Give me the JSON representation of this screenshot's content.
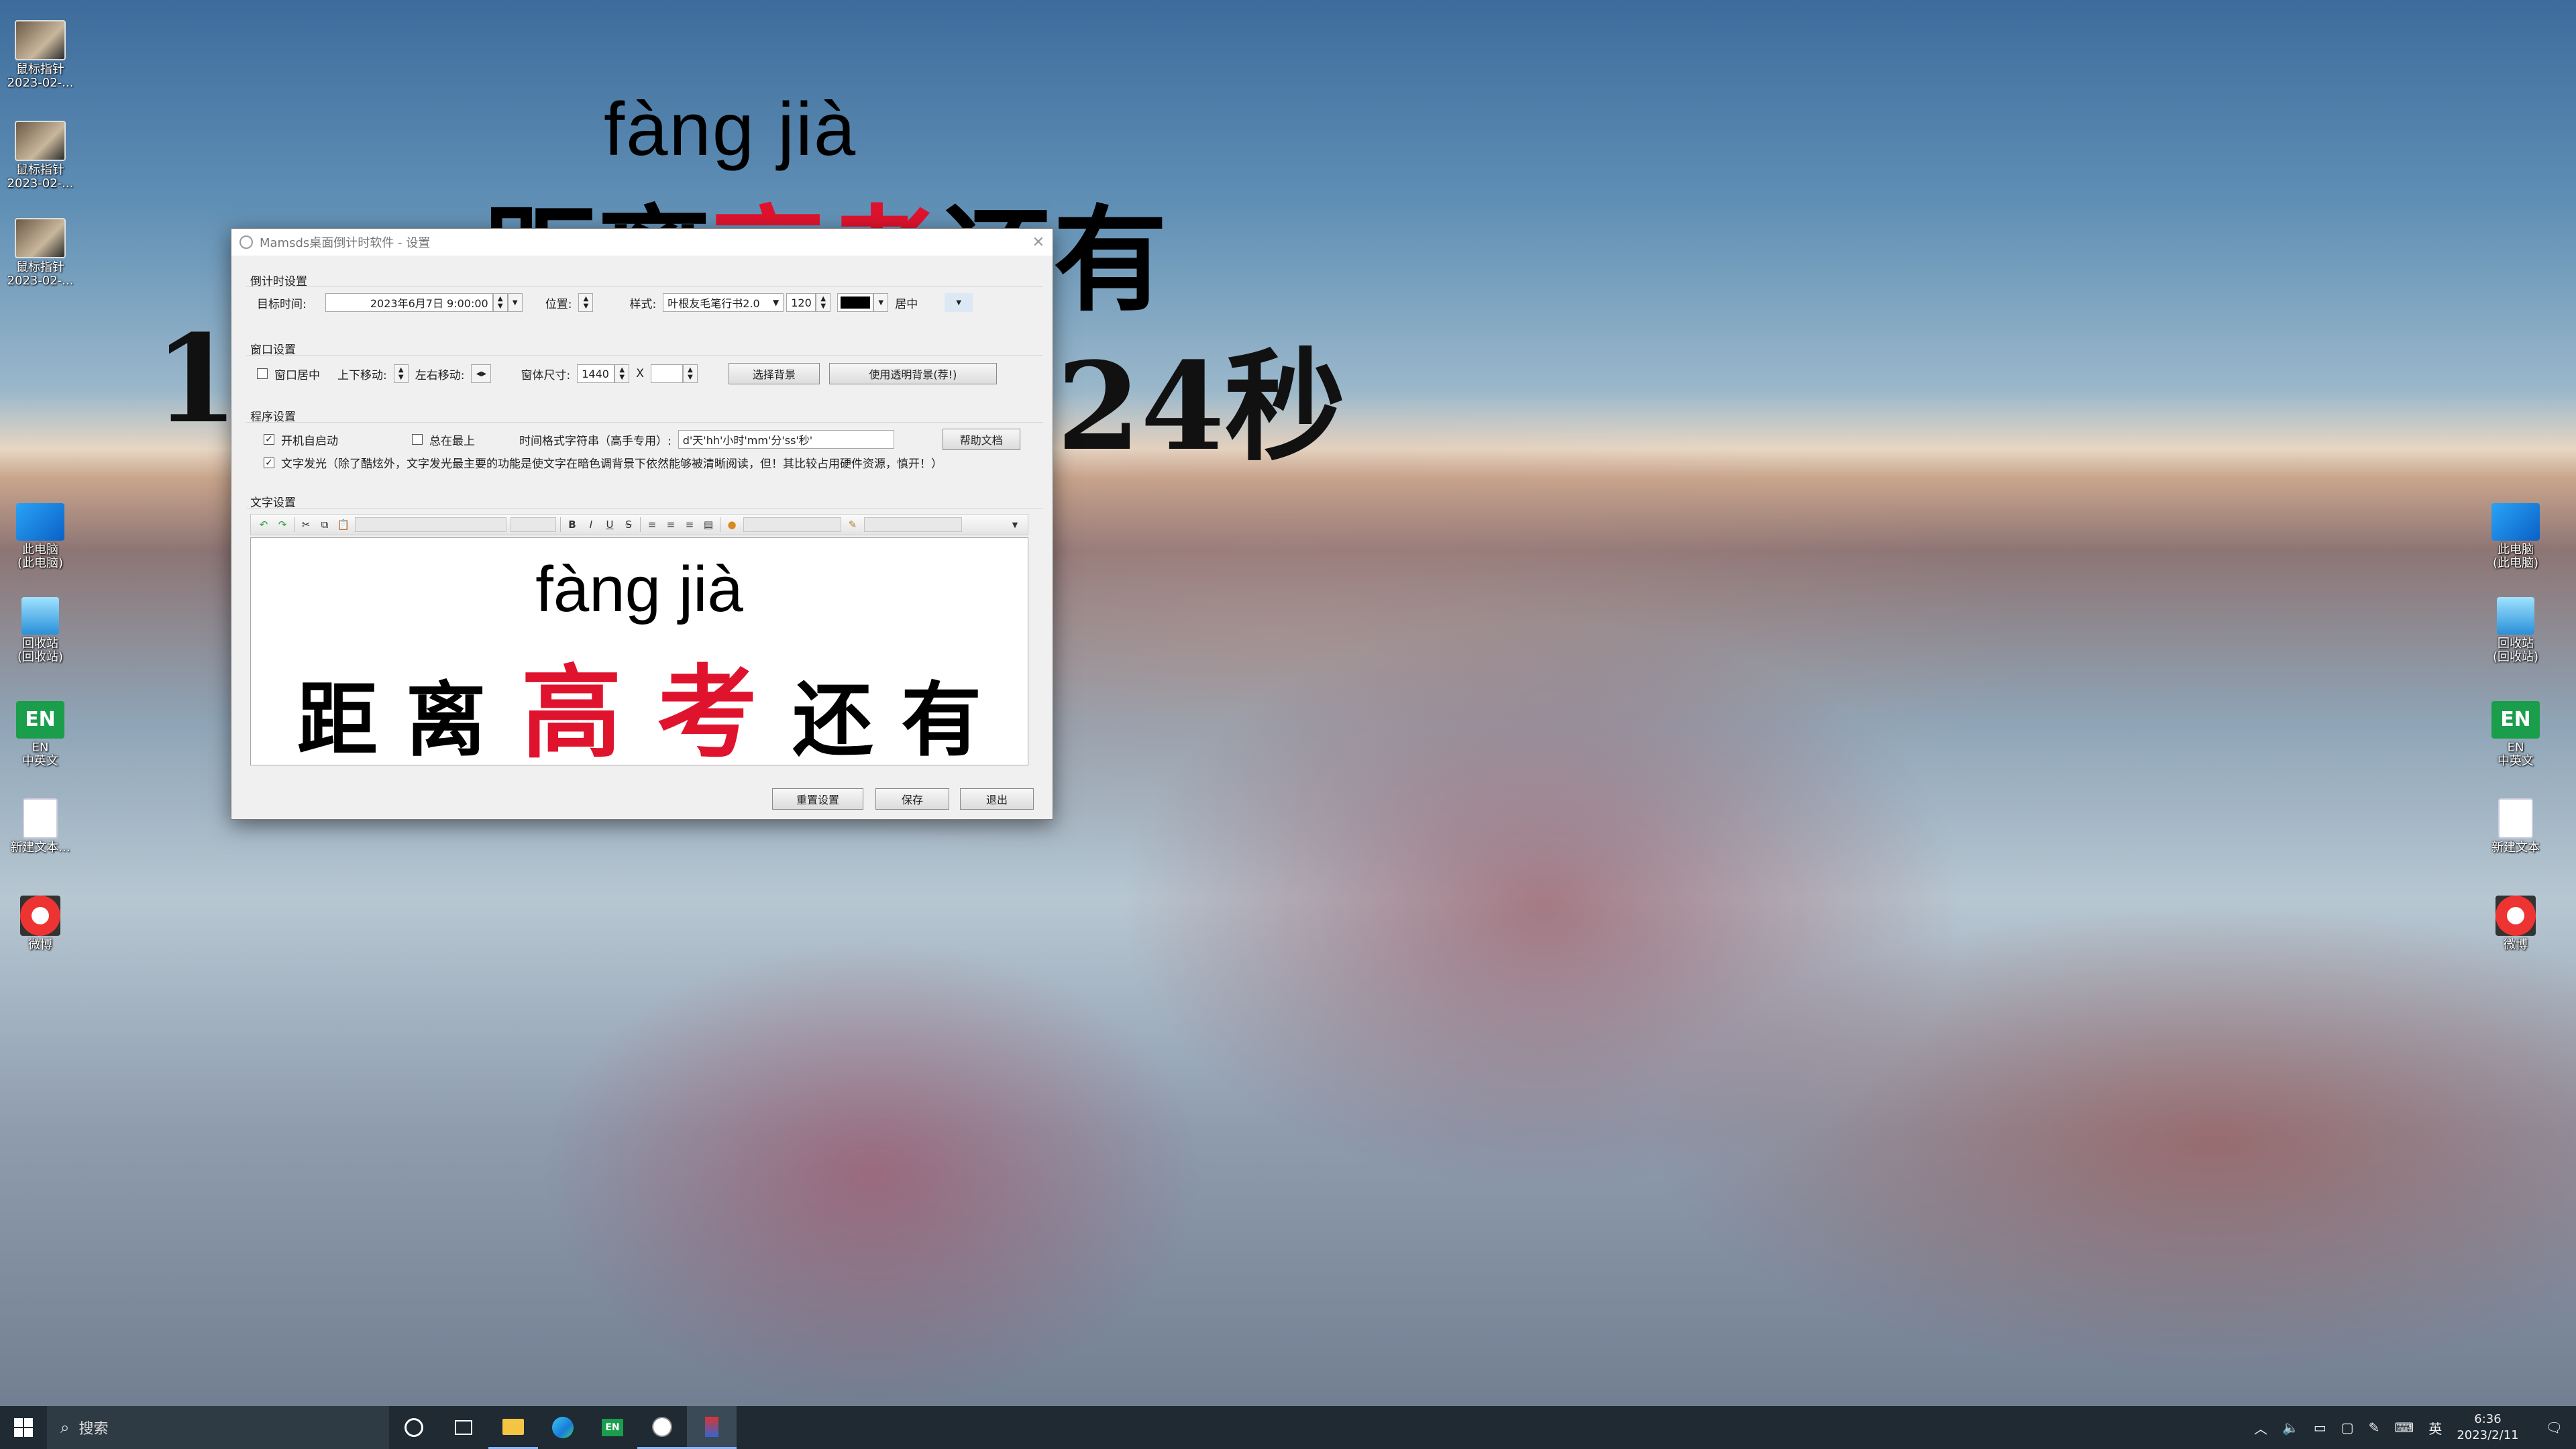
{
  "overlay": {
    "pinyin": "fàng  jià",
    "chars_black_left": "距离",
    "chars_red": "高考",
    "chars_black_right": "还有",
    "countdown_left": "11",
    "countdown_right": "24秒"
  },
  "desktop_icons_left": [
    {
      "label": "鼠标指针\n2023-02-...",
      "icon": "video-thumbnail-icon"
    },
    {
      "label": "鼠标指针\n2023-02-...",
      "icon": "video-thumbnail-icon"
    },
    {
      "label": "鼠标指针\n2023-02-...",
      "icon": "video-thumbnail-icon"
    },
    {
      "label": "此电脑\n(此电脑)",
      "icon": "computer-icon"
    },
    {
      "label": "回收站\n(回收站)",
      "icon": "recycle-bin-icon"
    },
    {
      "label": "EN\n中英文",
      "icon": "en-app-icon"
    },
    {
      "label": "新建文本...",
      "icon": "document-icon"
    },
    {
      "label": "微博",
      "icon": "weibo-icon"
    }
  ],
  "desktop_icons_right": [
    {
      "label": "此电脑\n(此电脑)",
      "icon": "computer-icon"
    },
    {
      "label": "回收站\n(回收站)",
      "icon": "recycle-bin-icon"
    },
    {
      "label": "EN\n中英文",
      "icon": "en-app-icon"
    },
    {
      "label": "新建文本",
      "icon": "document-icon"
    },
    {
      "label": "微博",
      "icon": "weibo-icon"
    }
  ],
  "window": {
    "title": "Mamsds桌面倒计时软件 - 设置",
    "countdown_group": "倒计时设置",
    "target_time_label": "目标时间:",
    "target_time_value": "2023年6月7日 9:00:00",
    "position_label": "位置:",
    "style_label": "样式:",
    "font_value": "叶根友毛笔行书2.0",
    "font_size": "120",
    "color_value": "#000000",
    "align_value": "居中",
    "window_group": "窗口设置",
    "center_window": "窗口居中",
    "move_vertical": "上下移动:",
    "move_horizontal": "左右移动:",
    "window_size_label": "窗体尺寸:",
    "width_value": "1440",
    "x_sep": "X",
    "height_value": "",
    "choose_bg": "选择背景",
    "use_transparent": "使用透明背景(荐!)",
    "program_group": "程序设置",
    "autostart": "开机自启动",
    "always_top": "总在最上",
    "time_format_label": "时间格式字符串（高手专用）:",
    "time_format_value": "d'天'hh'小时'mm'分'ss'秒'",
    "help_doc": "帮助文档",
    "text_glow": "文字发光（除了酷炫外，文字发光最主要的功能是使文字在暗色调背景下依然能够被清晰阅读，但！其比较占用硬件资源，慎开！）",
    "text_group": "文字设置",
    "editor_pinyin": "fàng  jià",
    "editor_chars_left": "距 离",
    "editor_chars_red": "高 考",
    "editor_chars_right": "还 有",
    "reset": "重置设置",
    "save": "保存",
    "exit": "退出"
  },
  "taskbar": {
    "search_placeholder": "搜索",
    "ime": "英",
    "time": "6:36",
    "date": "2023/2/11"
  }
}
